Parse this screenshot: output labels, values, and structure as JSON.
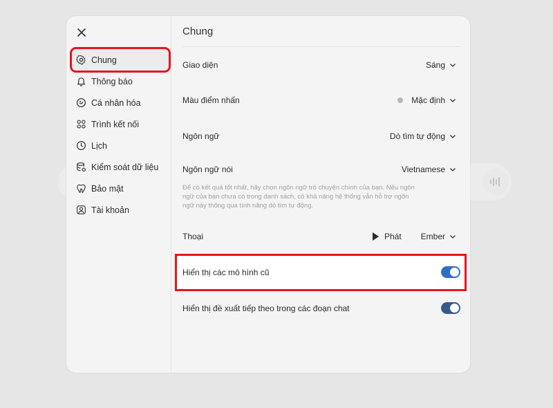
{
  "modal": {
    "title": "Chung"
  },
  "sidebar": {
    "items": [
      {
        "label": "Chung",
        "icon": "gear-icon",
        "active": true
      },
      {
        "label": "Thông báo",
        "icon": "bell-icon"
      },
      {
        "label": "Cá nhân hóa",
        "icon": "personalize-icon"
      },
      {
        "label": "Trình kết nối",
        "icon": "connector-icon"
      },
      {
        "label": "Lịch",
        "icon": "clock-icon"
      },
      {
        "label": "Kiểm soát dữ liệu",
        "icon": "database-icon"
      },
      {
        "label": "Bảo mật",
        "icon": "shield-icon"
      },
      {
        "label": "Tài khoản",
        "icon": "account-icon"
      }
    ]
  },
  "settings": {
    "theme": {
      "label": "Giao diện",
      "value": "Sáng"
    },
    "accent": {
      "label": "Màu điểm nhấn",
      "value": "Mặc định"
    },
    "language": {
      "label": "Ngôn ngữ",
      "value": "Dò tìm tự động"
    },
    "spoken_language": {
      "label": "Ngôn ngữ nói",
      "value": "Vietnamese",
      "description": "Để có kết quả tốt nhất, hãy chọn ngôn ngữ trò chuyện chính của bạn. Nếu ngôn ngữ của bạn chưa có trong danh sách, có khả năng hệ thống vẫn hỗ trợ ngôn ngữ này thông qua tính năng dò tìm tự động."
    },
    "voice": {
      "label": "Thoại",
      "play_label": "Phát",
      "value": "Ember"
    },
    "legacy_models": {
      "label": "Hiển thị các mô hình cũ",
      "enabled": true
    },
    "followups": {
      "label": "Hiển thị đề xuất tiếp theo trong các đoạn chat",
      "enabled": true
    }
  },
  "colors": {
    "accent_toggle": "#2f6ec7",
    "highlight_outline": "#e8141c"
  }
}
